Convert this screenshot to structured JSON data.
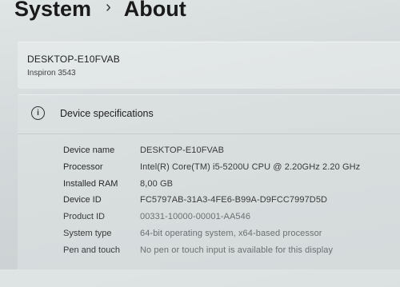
{
  "breadcrumb": {
    "parent": "System",
    "separator": "›",
    "current": "About"
  },
  "device": {
    "name": "DESKTOP-E10FVAB",
    "model": "Inspiron 3543"
  },
  "specs": {
    "title": "Device specifications",
    "icon": "info-icon",
    "rows": [
      {
        "label": "Device name",
        "value": "DESKTOP-E10FVAB"
      },
      {
        "label": "Processor",
        "value": "Intel(R) Core(TM) i5-5200U CPU @ 2.20GHz   2.20 GHz"
      },
      {
        "label": "Installed RAM",
        "value": "8,00 GB"
      },
      {
        "label": "Device ID",
        "value": "FC5797AB-31A3-4FE6-B99A-D9FCC7997D5D"
      },
      {
        "label": "Product ID",
        "value": "00331-10000-00001-AA546"
      },
      {
        "label": "System type",
        "value": "64-bit operating system, x64-based processor"
      },
      {
        "label": "Pen and touch",
        "value": "No pen or touch input is available for this display"
      }
    ]
  },
  "colors": {
    "background": "#d3d9da",
    "text": "#1b1b1b",
    "muted_text": "#6b6f70"
  }
}
